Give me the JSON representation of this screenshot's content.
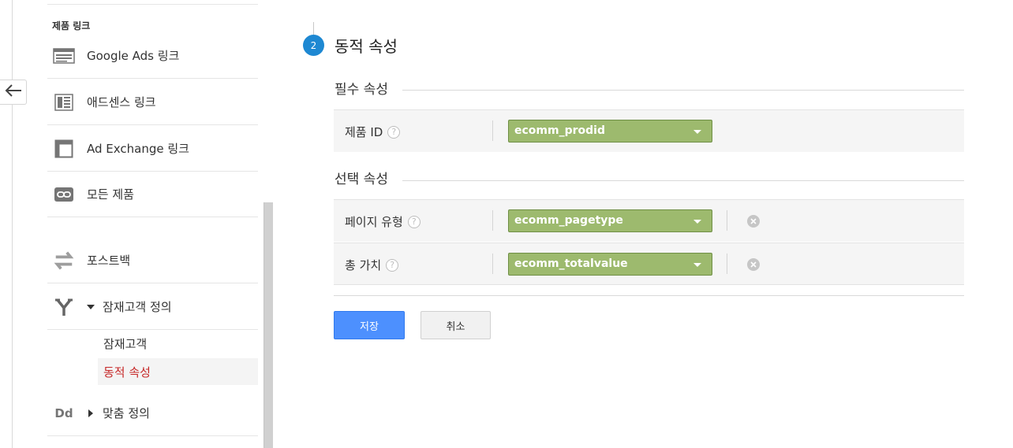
{
  "sidebar": {
    "section_header": "제품 링크",
    "items": [
      {
        "label": "Google Ads 링크",
        "icon": "google-ads-icon"
      },
      {
        "label": "애드센스 링크",
        "icon": "adsense-icon"
      },
      {
        "label": "Ad Exchange 링크",
        "icon": "ad-exchange-icon"
      },
      {
        "label": "모든 제품",
        "icon": "link-icon"
      },
      {
        "label": "포스트백",
        "icon": "postback-icon"
      },
      {
        "label": "잠재고객 정의",
        "icon": "audience-definitions-icon",
        "expanded": true
      },
      {
        "label": "맞춤 정의",
        "icon": "custom-definitions-icon",
        "icon_text": "Dd",
        "expanded": false
      }
    ],
    "subitems": [
      {
        "label": "잠재고객",
        "active": false
      },
      {
        "label": "동적 속성",
        "active": true
      }
    ]
  },
  "step": {
    "number": "2",
    "title": "동적 속성"
  },
  "required_section": {
    "title": "필수 속성",
    "rows": [
      {
        "label": "제품 ID",
        "help": "?",
        "value": "ecomm_prodid"
      }
    ]
  },
  "optional_section": {
    "title": "선택 속성",
    "rows": [
      {
        "label": "페이지 유형",
        "help": "?",
        "value": "ecomm_pagetype"
      },
      {
        "label": "총 가치",
        "help": "?",
        "value": "ecomm_totalvalue"
      }
    ]
  },
  "buttons": {
    "save": "저장",
    "cancel": "취소"
  },
  "colors": {
    "accent_blue": "#4d90fe",
    "step_badge": "#1e88d2",
    "dropdown_green": "#9dba6e",
    "active_red": "#c62828"
  }
}
